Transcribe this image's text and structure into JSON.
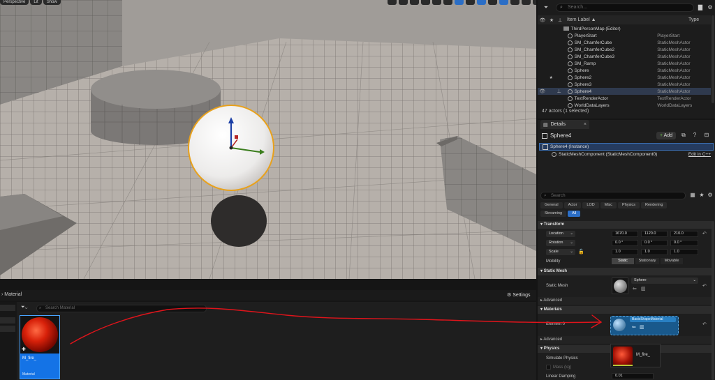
{
  "viewport": {
    "top_left_buttons": [
      "Perspective",
      "Lit",
      "Show"
    ]
  },
  "outliner": {
    "search_placeholder": "Search...",
    "columns": {
      "label": "Item Label ▲",
      "type": "Type"
    },
    "rows": [
      {
        "label": "ThirdPersonMap (Editor)",
        "type": "",
        "icon": "map-icon",
        "star": false,
        "pin": false,
        "eye": false,
        "selected": false,
        "indent": 1
      },
      {
        "label": "PlayerStart",
        "type": "PlayerStart",
        "icon": "player-start-icon",
        "star": false,
        "pin": false,
        "eye": false,
        "selected": false,
        "indent": 2
      },
      {
        "label": "SM_ChamferCube",
        "type": "StaticMeshActor",
        "icon": "static-mesh-icon",
        "star": false,
        "pin": false,
        "eye": false,
        "selected": false,
        "indent": 2
      },
      {
        "label": "SM_ChamferCube2",
        "type": "StaticMeshActor",
        "icon": "static-mesh-icon",
        "star": false,
        "pin": false,
        "eye": false,
        "selected": false,
        "indent": 2
      },
      {
        "label": "SM_ChamferCube3",
        "type": "StaticMeshActor",
        "icon": "static-mesh-icon",
        "star": false,
        "pin": false,
        "eye": false,
        "selected": false,
        "indent": 2
      },
      {
        "label": "SM_Ramp",
        "type": "StaticMeshActor",
        "icon": "static-mesh-icon",
        "star": false,
        "pin": false,
        "eye": false,
        "selected": false,
        "indent": 2
      },
      {
        "label": "Sphere",
        "type": "StaticMeshActor",
        "icon": "static-mesh-icon",
        "star": false,
        "pin": false,
        "eye": false,
        "selected": false,
        "indent": 2
      },
      {
        "label": "Sphere2",
        "type": "StaticMeshActor",
        "icon": "static-mesh-icon",
        "star": true,
        "pin": false,
        "eye": false,
        "selected": false,
        "indent": 2
      },
      {
        "label": "Sphere3",
        "type": "StaticMeshActor",
        "icon": "static-mesh-icon",
        "star": false,
        "pin": false,
        "eye": false,
        "selected": false,
        "indent": 2
      },
      {
        "label": "Sphere4",
        "type": "StaticMeshActor",
        "icon": "static-mesh-icon",
        "star": false,
        "pin": true,
        "eye": true,
        "selected": true,
        "indent": 2
      },
      {
        "label": "TextRenderActor",
        "type": "TextRenderActor",
        "icon": "text-render-icon",
        "star": false,
        "pin": false,
        "eye": false,
        "selected": false,
        "indent": 2
      },
      {
        "label": "WorldDataLayers",
        "type": "WorldDataLayers",
        "icon": "data-layers-icon",
        "star": false,
        "pin": false,
        "eye": false,
        "selected": false,
        "indent": 2
      }
    ],
    "footer": "47 actors (1 selected)"
  },
  "details": {
    "tab_label": "Details",
    "actor_name": "Sphere4",
    "add_label": "Add",
    "components": [
      {
        "label": "Sphere4 (Instance)",
        "selected": true
      },
      {
        "label": "StaticMeshComponent (StaticMeshComponent0)",
        "selected": false,
        "edit": "Edit in C++"
      }
    ],
    "search_placeholder": "Search",
    "categories_row1": [
      "General",
      "Actor",
      "LOD",
      "Misc",
      "Physics",
      "Rendering"
    ],
    "categories_row2": [
      "Streaming",
      "All"
    ],
    "active_category": "All",
    "transform": {
      "header": "Transform",
      "location": {
        "label": "Location",
        "values": [
          "1670.0",
          "1120.0",
          "210.0"
        ]
      },
      "rotation": {
        "label": "Rotation",
        "values": [
          "0.0 °",
          "0.0 °",
          "0.0 °"
        ]
      },
      "scale": {
        "label": "Scale",
        "values": [
          "1.0",
          "1.0",
          "1.0"
        ]
      },
      "mobility": {
        "label": "Mobility",
        "options": [
          "Static",
          "Stationary",
          "Movable"
        ],
        "selected": "Static"
      }
    },
    "static_mesh": {
      "header": "Static Mesh",
      "label": "Static Mesh",
      "value": "Sphere",
      "advanced": "Advanced"
    },
    "materials": {
      "header": "Materials",
      "element_label": "Element 0",
      "value": "BasicShapeMaterial",
      "advanced": "Advanced"
    },
    "physics": {
      "header": "Physics",
      "simulate": "Simulate Physics",
      "mass": "Mass (kg)",
      "linear_damping": "Linear Damping",
      "linear_damping_value": "0.01"
    }
  },
  "drag_preview": {
    "name": "M_fire_"
  },
  "content_browser": {
    "path_label": "Material",
    "settings_label": "Settings",
    "search_placeholder": "Search Material",
    "asset": {
      "name": "M_fire_",
      "type": "Material"
    }
  },
  "colors": {
    "selection_blue": "#2b6ec6",
    "annotation_red": "#e0141b",
    "sphere_outline": "#e8a11c"
  }
}
